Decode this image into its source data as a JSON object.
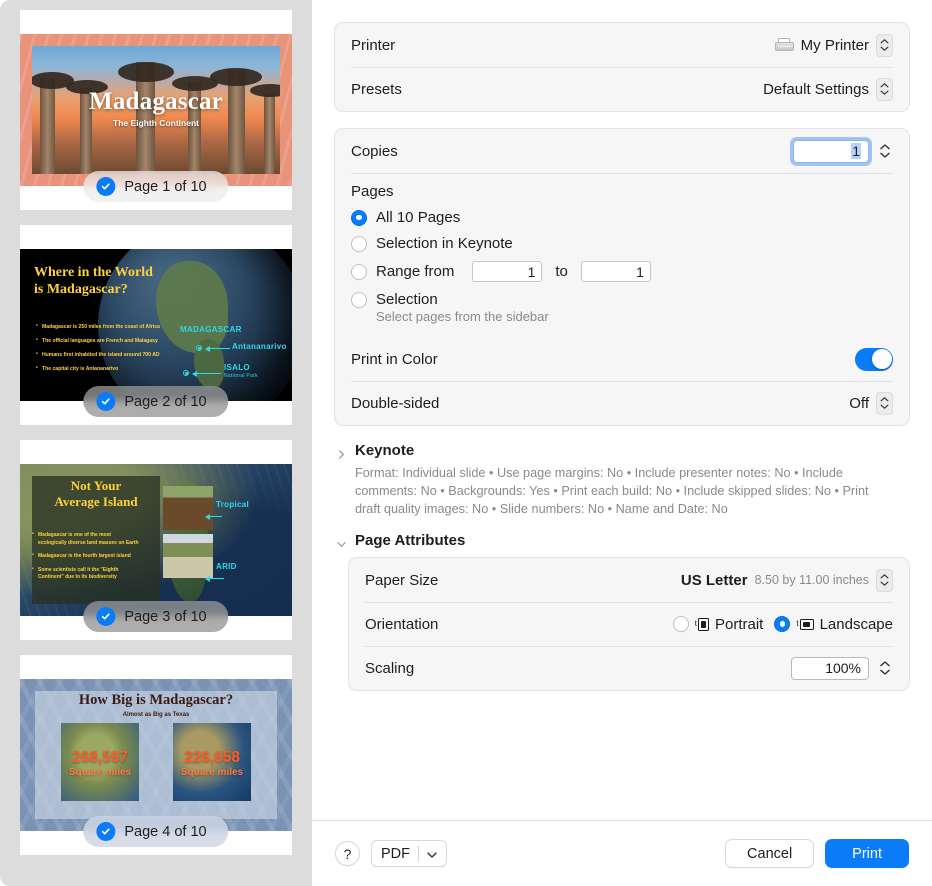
{
  "sidebar": {
    "pages": [
      {
        "pill_label": "Page 1 of 10",
        "selected": true,
        "title": "Madagascar",
        "subtitle": "The Eighth Continent"
      },
      {
        "pill_label": "Page 2 of 10",
        "selected": true,
        "title_line1": "Where in the World",
        "title_line2": "is Madagascar?",
        "bullets": [
          "Madagascar is 250 miles from the coast of Africa",
          "The official languages are French and Malagasy",
          "Humans first inhabited the island around 700 AD",
          "The capital city is Antananarivo"
        ],
        "annotations": [
          "MADAGASCAR",
          "Antananarivo",
          "ISALO",
          "National Park"
        ]
      },
      {
        "pill_label": "Page 3 of 10",
        "selected": true,
        "title_line1": "Not Your",
        "title_line2": "Average Island",
        "bullets": [
          "Madagascar is one of the most ecologically diverse land masses on Earth",
          "Madagascar is the fourth largest island",
          "Some scientists call it the \"Eighth Continent\" due to its biodiversity"
        ],
        "annotations": [
          "Tropical",
          "ARID"
        ]
      },
      {
        "pill_label": "Page 4 of 10",
        "selected": true,
        "title": "How Big is Madagascar?",
        "subtitle": "Almost as Big as Texas",
        "stats": [
          {
            "number": "268,597",
            "unit": "Square miles"
          },
          {
            "number": "226,658",
            "unit": "Square miles"
          }
        ]
      }
    ]
  },
  "printer_group": {
    "printer_label": "Printer",
    "printer_value": "My Printer",
    "presets_label": "Presets",
    "presets_value": "Default Settings"
  },
  "copies": {
    "label": "Copies",
    "value": "1"
  },
  "pages": {
    "title": "Pages",
    "options": [
      {
        "label": "All 10 Pages",
        "selected": true
      },
      {
        "label": "Selection in Keynote",
        "selected": false
      },
      {
        "label": "Range from",
        "selected": false
      },
      {
        "label": "Selection",
        "selected": false
      }
    ],
    "range_to_label": "to",
    "range_from_value": "1",
    "range_to_value": "1",
    "hint": "Select pages from the sidebar"
  },
  "print_in_color": {
    "label": "Print in Color",
    "on": true
  },
  "double_sided": {
    "label": "Double-sided",
    "value": "Off"
  },
  "keynote_section": {
    "title": "Keynote",
    "expanded": false,
    "summary": "Format: Individual slide • Use page margins: No • Include presenter notes: No • Include comments: No • Backgrounds: Yes • Print each build: No • Include skipped slides: No • Print draft quality images: No • Slide numbers: No • Name and Date: No"
  },
  "page_attributes": {
    "title": "Page Attributes",
    "expanded": true,
    "paper_size_label": "Paper Size",
    "paper_size_value": "US Letter",
    "paper_size_detail": "8.50 by 11.00 inches",
    "orientation_label": "Orientation",
    "orientation_options": [
      {
        "label": "Portrait",
        "selected": false
      },
      {
        "label": "Landscape",
        "selected": true
      }
    ],
    "scaling_label": "Scaling",
    "scaling_value": "100%"
  },
  "bottom_bar": {
    "help_label": "?",
    "pdf_label": "PDF",
    "cancel_label": "Cancel",
    "print_label": "Print"
  },
  "colors": {
    "accent": "#0a7cf7",
    "sidebar_bg": "#dcdcdc",
    "group_bg": "#f6f6f6"
  }
}
